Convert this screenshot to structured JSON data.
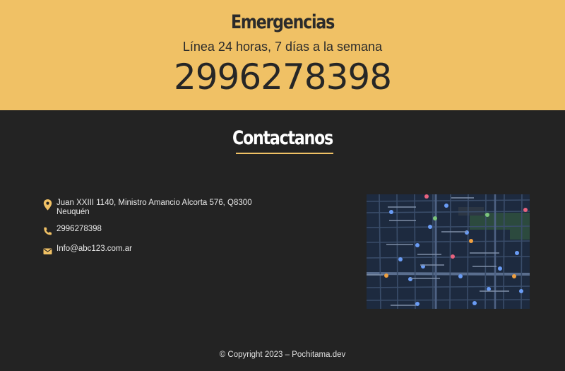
{
  "emergency": {
    "title": "Emergencias",
    "subtitle": "Línea 24 horas, 7 días a la semana",
    "phone": "2996278398"
  },
  "contact": {
    "title": "Contactanos",
    "address": "Juan XXIII 1140, Ministro Amancio Alcorta 576, Q8300 Neuquén",
    "phone": "2996278398",
    "email": "Info@abc123.com.ar"
  },
  "footer": {
    "copyright": "© Copyright 2023 – Pochitama.dev"
  },
  "colors": {
    "accent": "#f0c165",
    "background": "#232323",
    "text": "#e8e8e8"
  },
  "icons": {
    "address": "location-pin-icon",
    "phone": "phone-icon",
    "email": "envelope-icon"
  }
}
